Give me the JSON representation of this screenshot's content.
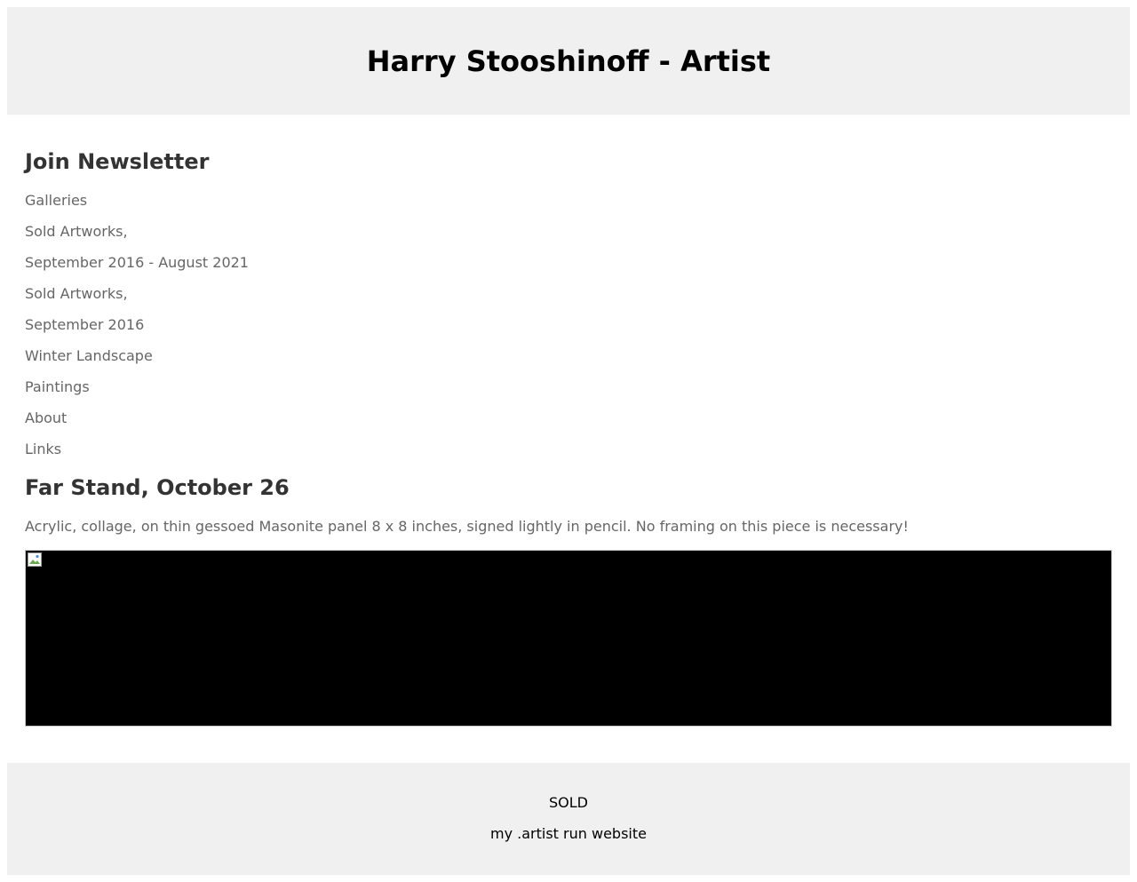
{
  "header": {
    "title": "Harry Stooshinoff - Artist"
  },
  "sidebar": {
    "newsletter_label": "Join Newsletter",
    "nav_items": [
      "Galleries",
      "Sold Artworks,",
      "September 2016 - August 2021",
      "Sold Artworks,",
      "September 2016",
      "Winter Landscape",
      "Paintings",
      "About",
      "Links"
    ]
  },
  "artwork": {
    "title": "Far Stand, October 26",
    "description": "Acrylic, collage, on thin gessoed Masonite panel 8 x 8 inches, signed lightly in pencil. No framing on this piece is necessary!",
    "image_icon": "broken-image-icon"
  },
  "footer": {
    "status": "SOLD",
    "credit_link": "my .artist run website"
  },
  "colors": {
    "header_bg": "#f0f0f0",
    "footer_bg": "#f0f0f0",
    "heading_text": "#333333",
    "body_text": "#666666"
  }
}
